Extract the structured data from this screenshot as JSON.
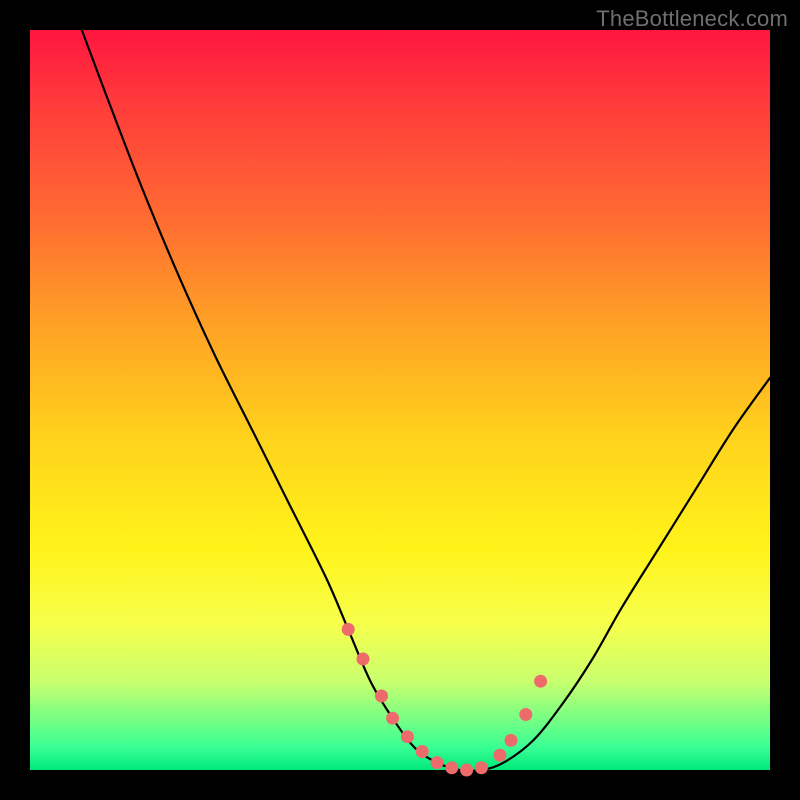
{
  "watermark": "TheBottleneck.com",
  "chart_data": {
    "type": "line",
    "title": "",
    "xlabel": "",
    "ylabel": "",
    "xlim": [
      0,
      100
    ],
    "ylim": [
      0,
      100
    ],
    "series": [
      {
        "name": "bottleneck-curve",
        "x": [
          7,
          10,
          15,
          20,
          25,
          30,
          35,
          40,
          43,
          46,
          49,
          52,
          55,
          58,
          61,
          64,
          68,
          72,
          76,
          80,
          85,
          90,
          95,
          100
        ],
        "values": [
          100,
          92,
          79,
          67,
          56,
          46,
          36,
          26,
          19,
          12,
          7,
          3,
          1,
          0,
          0,
          1,
          4,
          9,
          15,
          22,
          30,
          38,
          46,
          53
        ]
      }
    ],
    "markers": {
      "name": "highlight-dots",
      "color": "#ed6b6b",
      "x": [
        43,
        45,
        47.5,
        49,
        51,
        53,
        55,
        57,
        59,
        61,
        63.5,
        65,
        67,
        69
      ],
      "values": [
        19,
        15,
        10,
        7,
        4.5,
        2.5,
        1,
        0.3,
        0,
        0.3,
        2,
        4,
        7.5,
        12
      ]
    },
    "gradient_stops": [
      {
        "pos": 0,
        "color": "#ff163f"
      },
      {
        "pos": 10,
        "color": "#ff3b3b"
      },
      {
        "pos": 25,
        "color": "#ff6a32"
      },
      {
        "pos": 40,
        "color": "#ffa225"
      },
      {
        "pos": 55,
        "color": "#ffd21c"
      },
      {
        "pos": 70,
        "color": "#fff31a"
      },
      {
        "pos": 80,
        "color": "#f7ff4a"
      },
      {
        "pos": 88,
        "color": "#c9ff6e"
      },
      {
        "pos": 97,
        "color": "#38ff94"
      },
      {
        "pos": 100,
        "color": "#00e97a"
      }
    ]
  }
}
